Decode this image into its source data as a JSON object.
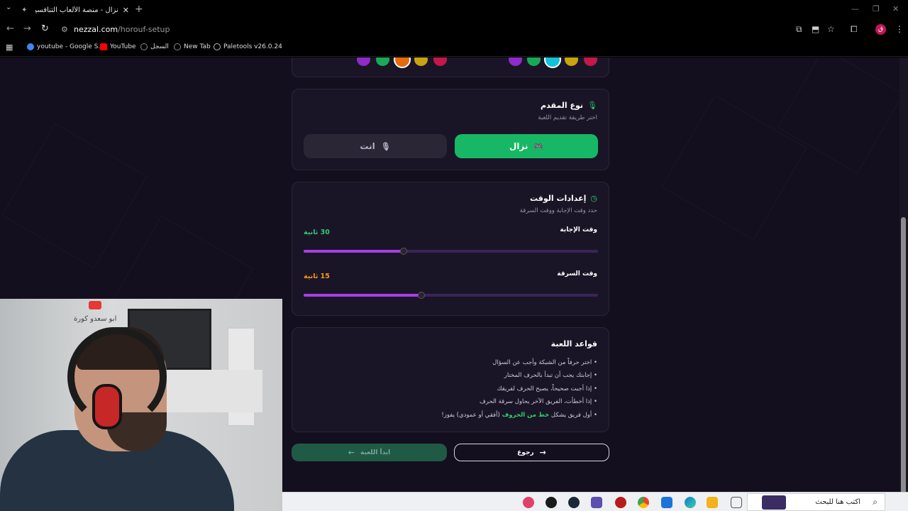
{
  "browser": {
    "tab_title": "نزال - منصة الألعاب التنافسية ال",
    "url_domain": "nezzal.com",
    "url_path": "/horouf-setup",
    "profile_initial": "ق",
    "bookmarks": [
      {
        "label": "youtube - Google S...",
        "color": "#4285f4"
      },
      {
        "label": "YouTube",
        "color": "#ff0000"
      },
      {
        "label": "السجل",
        "color": "#888888"
      },
      {
        "label": "New Tab",
        "color": "#888888"
      },
      {
        "label": "Paletools v26.0.24",
        "color": "#bbbbbb"
      }
    ]
  },
  "team_colors": {
    "left_row": [
      "#8e2bc9",
      "#18a957",
      "#e66a0b",
      "#c9a312",
      "#c2184a"
    ],
    "right_row": [
      "#8e2bc9",
      "#18a957",
      "#11c3d9",
      "#c9a312",
      "#c2184a"
    ],
    "selected_left": "#e66a0b",
    "selected_right": "#11c3d9"
  },
  "presenter": {
    "title": "نوع المقدم",
    "subtitle": "اختر طريقة تقديم اللعبة",
    "option_nezzal": "نزال",
    "option_you": "انت"
  },
  "time_settings": {
    "title": "إعدادات الوقت",
    "subtitle": "حدد وقت الإجابة ووقت السرقة",
    "answer_label": "وقت الإجابة",
    "answer_value": "30 ثانية",
    "answer_fraction": 0.34,
    "steal_label": "وقت السرقة",
    "steal_value": "15 ثانية",
    "steal_fraction": 0.4,
    "answer_color": "#2ecc71",
    "steal_color": "#f39c12"
  },
  "rules": {
    "title": "قواعد اللعبة",
    "items": [
      "• اختر حرفاً من الشبكة وأجب عن السؤال",
      "• إجابتك يجب أن تبدأ بالحرف المختار",
      "• إذا أجبت صحيحاً، يصبح الحرف لفريقك",
      "• إذا أخطأت، الفريق الآخر يحاول سرقة الحرف"
    ],
    "last_prefix": "• أول فريق يشكل ",
    "last_highlight": "خط من الحروف",
    "last_suffix": " (أفقي أو عمودي) يفوز!"
  },
  "actions": {
    "back": "رجوع",
    "start": "ابدأ اللعبة"
  },
  "webcam": {
    "channel_text": "ابو سعدو كورة"
  },
  "taskbar": {
    "search_placeholder": "اكتب هنا للبحث"
  }
}
